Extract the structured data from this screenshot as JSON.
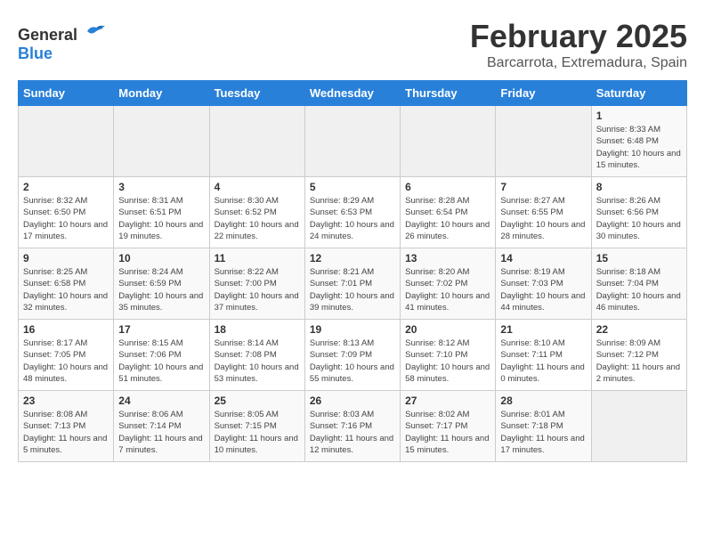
{
  "header": {
    "logo_general": "General",
    "logo_blue": "Blue",
    "title": "February 2025",
    "subtitle": "Barcarrota, Extremadura, Spain"
  },
  "calendar": {
    "days_of_week": [
      "Sunday",
      "Monday",
      "Tuesday",
      "Wednesday",
      "Thursday",
      "Friday",
      "Saturday"
    ],
    "weeks": [
      [
        {
          "day": "",
          "info": ""
        },
        {
          "day": "",
          "info": ""
        },
        {
          "day": "",
          "info": ""
        },
        {
          "day": "",
          "info": ""
        },
        {
          "day": "",
          "info": ""
        },
        {
          "day": "",
          "info": ""
        },
        {
          "day": "1",
          "info": "Sunrise: 8:33 AM\nSunset: 6:48 PM\nDaylight: 10 hours and 15 minutes."
        }
      ],
      [
        {
          "day": "2",
          "info": "Sunrise: 8:32 AM\nSunset: 6:50 PM\nDaylight: 10 hours and 17 minutes."
        },
        {
          "day": "3",
          "info": "Sunrise: 8:31 AM\nSunset: 6:51 PM\nDaylight: 10 hours and 19 minutes."
        },
        {
          "day": "4",
          "info": "Sunrise: 8:30 AM\nSunset: 6:52 PM\nDaylight: 10 hours and 22 minutes."
        },
        {
          "day": "5",
          "info": "Sunrise: 8:29 AM\nSunset: 6:53 PM\nDaylight: 10 hours and 24 minutes."
        },
        {
          "day": "6",
          "info": "Sunrise: 8:28 AM\nSunset: 6:54 PM\nDaylight: 10 hours and 26 minutes."
        },
        {
          "day": "7",
          "info": "Sunrise: 8:27 AM\nSunset: 6:55 PM\nDaylight: 10 hours and 28 minutes."
        },
        {
          "day": "8",
          "info": "Sunrise: 8:26 AM\nSunset: 6:56 PM\nDaylight: 10 hours and 30 minutes."
        }
      ],
      [
        {
          "day": "9",
          "info": "Sunrise: 8:25 AM\nSunset: 6:58 PM\nDaylight: 10 hours and 32 minutes."
        },
        {
          "day": "10",
          "info": "Sunrise: 8:24 AM\nSunset: 6:59 PM\nDaylight: 10 hours and 35 minutes."
        },
        {
          "day": "11",
          "info": "Sunrise: 8:22 AM\nSunset: 7:00 PM\nDaylight: 10 hours and 37 minutes."
        },
        {
          "day": "12",
          "info": "Sunrise: 8:21 AM\nSunset: 7:01 PM\nDaylight: 10 hours and 39 minutes."
        },
        {
          "day": "13",
          "info": "Sunrise: 8:20 AM\nSunset: 7:02 PM\nDaylight: 10 hours and 41 minutes."
        },
        {
          "day": "14",
          "info": "Sunrise: 8:19 AM\nSunset: 7:03 PM\nDaylight: 10 hours and 44 minutes."
        },
        {
          "day": "15",
          "info": "Sunrise: 8:18 AM\nSunset: 7:04 PM\nDaylight: 10 hours and 46 minutes."
        }
      ],
      [
        {
          "day": "16",
          "info": "Sunrise: 8:17 AM\nSunset: 7:05 PM\nDaylight: 10 hours and 48 minutes."
        },
        {
          "day": "17",
          "info": "Sunrise: 8:15 AM\nSunset: 7:06 PM\nDaylight: 10 hours and 51 minutes."
        },
        {
          "day": "18",
          "info": "Sunrise: 8:14 AM\nSunset: 7:08 PM\nDaylight: 10 hours and 53 minutes."
        },
        {
          "day": "19",
          "info": "Sunrise: 8:13 AM\nSunset: 7:09 PM\nDaylight: 10 hours and 55 minutes."
        },
        {
          "day": "20",
          "info": "Sunrise: 8:12 AM\nSunset: 7:10 PM\nDaylight: 10 hours and 58 minutes."
        },
        {
          "day": "21",
          "info": "Sunrise: 8:10 AM\nSunset: 7:11 PM\nDaylight: 11 hours and 0 minutes."
        },
        {
          "day": "22",
          "info": "Sunrise: 8:09 AM\nSunset: 7:12 PM\nDaylight: 11 hours and 2 minutes."
        }
      ],
      [
        {
          "day": "23",
          "info": "Sunrise: 8:08 AM\nSunset: 7:13 PM\nDaylight: 11 hours and 5 minutes."
        },
        {
          "day": "24",
          "info": "Sunrise: 8:06 AM\nSunset: 7:14 PM\nDaylight: 11 hours and 7 minutes."
        },
        {
          "day": "25",
          "info": "Sunrise: 8:05 AM\nSunset: 7:15 PM\nDaylight: 11 hours and 10 minutes."
        },
        {
          "day": "26",
          "info": "Sunrise: 8:03 AM\nSunset: 7:16 PM\nDaylight: 11 hours and 12 minutes."
        },
        {
          "day": "27",
          "info": "Sunrise: 8:02 AM\nSunset: 7:17 PM\nDaylight: 11 hours and 15 minutes."
        },
        {
          "day": "28",
          "info": "Sunrise: 8:01 AM\nSunset: 7:18 PM\nDaylight: 11 hours and 17 minutes."
        },
        {
          "day": "",
          "info": ""
        }
      ]
    ]
  }
}
